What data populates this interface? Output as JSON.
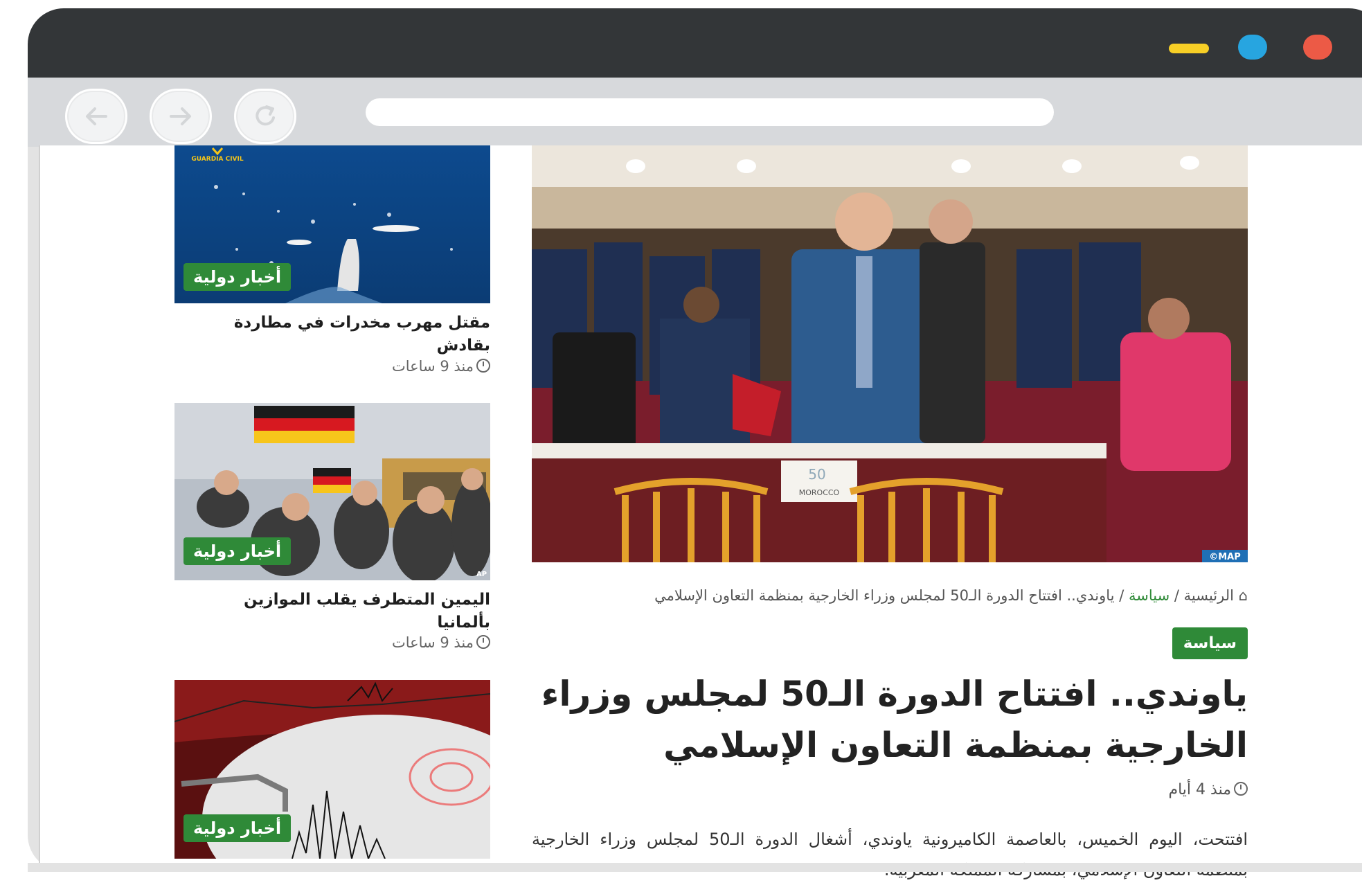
{
  "sidebar": {
    "cards": [
      {
        "badge": "أخبار دولية",
        "title_line1": "مقتل مهرب مخدرات في مطاردة",
        "title_line2": "بقادش",
        "time": "منذ 9 ساعات",
        "watermark": "GUARDIA CIVIL"
      },
      {
        "badge": "أخبار دولية",
        "title_line1": "اليمين المتطرف يقلب الموازين",
        "title_line2": "بألمانيا",
        "time": "منذ 9 ساعات",
        "watermark": "AP"
      },
      {
        "badge": "أخبار دولية"
      }
    ]
  },
  "article": {
    "image_credit": "©MAP",
    "image_placard": "MOROCCO",
    "image_logo": "50",
    "breadcrumb": {
      "home": "الرئيسية",
      "sep": "/",
      "category": "سياسة",
      "current": "ياوندي.. افتتاح الدورة الـ50 لمجلس وزراء الخارجية بمنظمة التعاون الإسلامي"
    },
    "category_badge": "سياسة",
    "headline_line1": "ياوندي.. افتتاح الدورة الـ50 لمجلس وزراء",
    "headline_line2": "الخارجية بمنظمة التعاون الإسلامي",
    "time": "منذ 4 أيام",
    "lead": "افتتحت، اليوم الخميس، بالعاصمة الكاميرونية ياوندي، أشغال الدورة الـ50 لمجلس وزراء الخارجية بمنظمة التعاون الإسلامي، بمشاركة المملكة المغربية."
  },
  "colors": {
    "accent": "#2f8a38",
    "titlebar": "#333638",
    "toolbar": "#d7d9dc"
  }
}
